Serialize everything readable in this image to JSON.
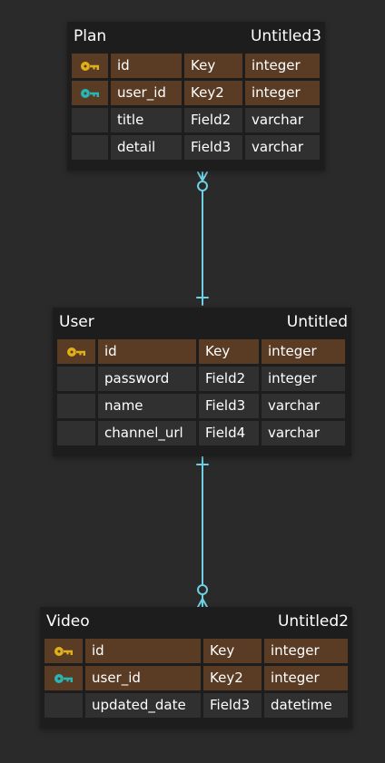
{
  "colors": {
    "background": "#2a2a2a",
    "table_body": "#1d1d1d",
    "key_row": "#5a3b24",
    "field_row": "#303030",
    "primary_key_icon": "#e0b01a",
    "foreign_key_icon": "#27b6b6",
    "relationship_line": "#6fd0e3"
  },
  "tables": {
    "plan": {
      "name": "Plan",
      "label": "Untitled3",
      "rows": [
        {
          "icon": "primary-key-icon",
          "name": "id",
          "key": "Key",
          "type": "integer"
        },
        {
          "icon": "foreign-key-icon",
          "name": "user_id",
          "key": "Key2",
          "type": "integer"
        },
        {
          "icon": "",
          "name": "title",
          "key": "Field2",
          "type": "varchar"
        },
        {
          "icon": "",
          "name": "detail",
          "key": "Field3",
          "type": "varchar"
        }
      ]
    },
    "user": {
      "name": "User",
      "label": "Untitled",
      "rows": [
        {
          "icon": "primary-key-icon",
          "name": "id",
          "key": "Key",
          "type": "integer"
        },
        {
          "icon": "",
          "name": "password",
          "key": "Field2",
          "type": "integer"
        },
        {
          "icon": "",
          "name": "name",
          "key": "Field3",
          "type": "varchar"
        },
        {
          "icon": "",
          "name": "channel_url",
          "key": "Field4",
          "type": "varchar"
        }
      ]
    },
    "video": {
      "name": "Video",
      "label": "Untitled2",
      "rows": [
        {
          "icon": "primary-key-icon",
          "name": "id",
          "key": "Key",
          "type": "integer"
        },
        {
          "icon": "foreign-key-icon",
          "name": "user_id",
          "key": "Key2",
          "type": "integer"
        },
        {
          "icon": "",
          "name": "updated_date",
          "key": "Field3",
          "type": "datetime"
        }
      ]
    }
  },
  "relationships": [
    {
      "from": "user",
      "to": "plan",
      "from_end": "one",
      "to_end": "zero-or-many"
    },
    {
      "from": "user",
      "to": "video",
      "from_end": "one",
      "to_end": "zero-or-many"
    }
  ]
}
